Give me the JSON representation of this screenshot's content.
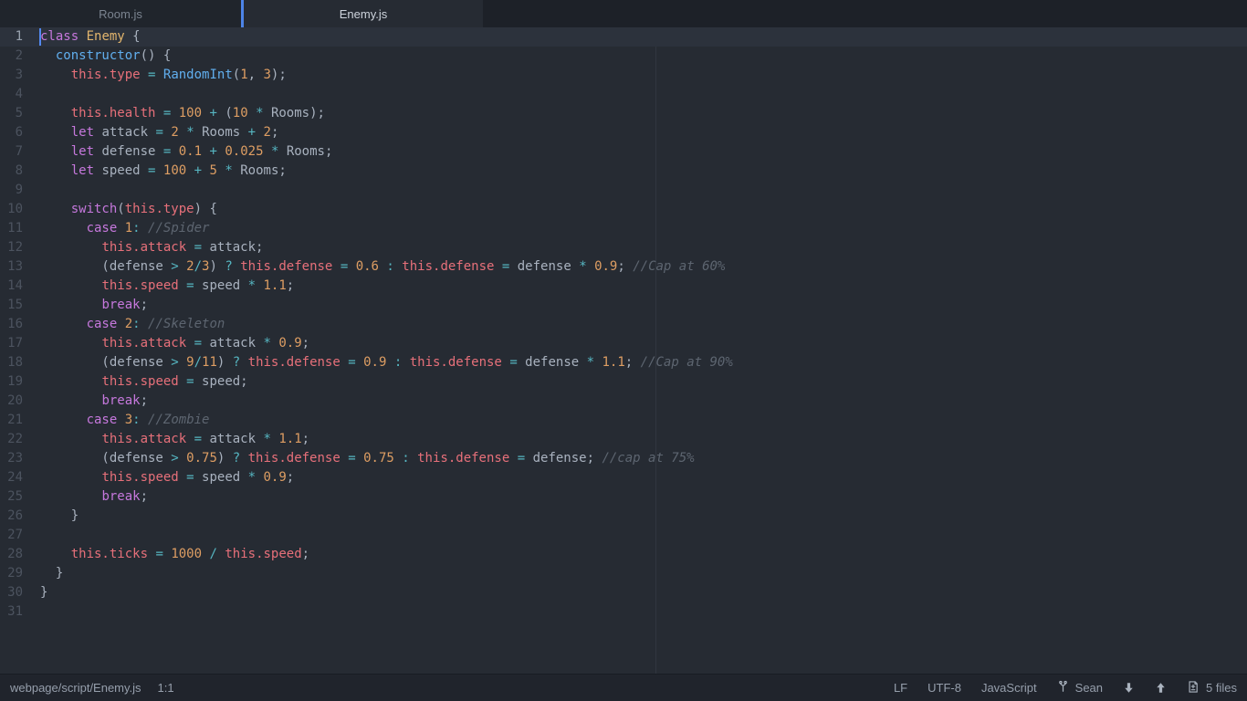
{
  "colors": {
    "bg-editor": "#262b33",
    "bg-tabbar": "#1d2128",
    "bg-tab-inactive": "#20252c",
    "bg-tab-active": "#262b33",
    "bg-statusbar": "#20242c",
    "bg-current-line": "#2c323c",
    "accent": "#4d84e8",
    "caret": "#5389f0",
    "wrap-guide": "#31363f",
    "line-number": "#4c535f",
    "line-number-active": "#98a1ae",
    "tab-text-inactive": "#7b8490",
    "tab-text-active": "#cdd3dc",
    "status-text": "#969fac",
    "status-icon": "#aab3bf",
    "kw": "#c678dd",
    "fn": "#61afef",
    "thiskw": "#e7707a",
    "num": "#de9e63",
    "op": "#56b6c2",
    "pl": "#a9b2bf",
    "cls": "#e2b56d",
    "cm": "#5d6570"
  },
  "tabs": [
    {
      "label": "Room.js",
      "active": false
    },
    {
      "label": "Enemy.js",
      "active": true
    }
  ],
  "editor": {
    "cursor_line": 1,
    "lines": [
      {
        "n": 1,
        "segs": [
          [
            "kw",
            "class"
          ],
          [
            "pl",
            " "
          ],
          [
            "cls",
            "Enemy"
          ],
          [
            "pl",
            " {"
          ]
        ]
      },
      {
        "n": 2,
        "segs": [
          [
            "pl",
            "  "
          ],
          [
            "fn",
            "constructor"
          ],
          [
            "pl",
            "() {"
          ]
        ]
      },
      {
        "n": 3,
        "segs": [
          [
            "pl",
            "    "
          ],
          [
            "this",
            "this.type"
          ],
          [
            "pl",
            " "
          ],
          [
            "op",
            "="
          ],
          [
            "pl",
            " "
          ],
          [
            "fn",
            "RandomInt"
          ],
          [
            "pl",
            "("
          ],
          [
            "num",
            "1"
          ],
          [
            "pl",
            ", "
          ],
          [
            "num",
            "3"
          ],
          [
            "pl",
            ");"
          ]
        ]
      },
      {
        "n": 4,
        "segs": []
      },
      {
        "n": 5,
        "segs": [
          [
            "pl",
            "    "
          ],
          [
            "this",
            "this.health"
          ],
          [
            "pl",
            " "
          ],
          [
            "op",
            "="
          ],
          [
            "pl",
            " "
          ],
          [
            "num",
            "100"
          ],
          [
            "pl",
            " "
          ],
          [
            "op",
            "+"
          ],
          [
            "pl",
            " ("
          ],
          [
            "num",
            "10"
          ],
          [
            "pl",
            " "
          ],
          [
            "op",
            "*"
          ],
          [
            "pl",
            " Rooms);"
          ]
        ]
      },
      {
        "n": 6,
        "segs": [
          [
            "pl",
            "    "
          ],
          [
            "kw",
            "let"
          ],
          [
            "pl",
            " attack "
          ],
          [
            "op",
            "="
          ],
          [
            "pl",
            " "
          ],
          [
            "num",
            "2"
          ],
          [
            "pl",
            " "
          ],
          [
            "op",
            "*"
          ],
          [
            "pl",
            " Rooms "
          ],
          [
            "op",
            "+"
          ],
          [
            "pl",
            " "
          ],
          [
            "num",
            "2"
          ],
          [
            "pl",
            ";"
          ]
        ]
      },
      {
        "n": 7,
        "segs": [
          [
            "pl",
            "    "
          ],
          [
            "kw",
            "let"
          ],
          [
            "pl",
            " defense "
          ],
          [
            "op",
            "="
          ],
          [
            "pl",
            " "
          ],
          [
            "num",
            "0.1"
          ],
          [
            "pl",
            " "
          ],
          [
            "op",
            "+"
          ],
          [
            "pl",
            " "
          ],
          [
            "num",
            "0.025"
          ],
          [
            "pl",
            " "
          ],
          [
            "op",
            "*"
          ],
          [
            "pl",
            " Rooms;"
          ]
        ]
      },
      {
        "n": 8,
        "segs": [
          [
            "pl",
            "    "
          ],
          [
            "kw",
            "let"
          ],
          [
            "pl",
            " speed "
          ],
          [
            "op",
            "="
          ],
          [
            "pl",
            " "
          ],
          [
            "num",
            "100"
          ],
          [
            "pl",
            " "
          ],
          [
            "op",
            "+"
          ],
          [
            "pl",
            " "
          ],
          [
            "num",
            "5"
          ],
          [
            "pl",
            " "
          ],
          [
            "op",
            "*"
          ],
          [
            "pl",
            " Rooms;"
          ]
        ]
      },
      {
        "n": 9,
        "segs": []
      },
      {
        "n": 10,
        "segs": [
          [
            "pl",
            "    "
          ],
          [
            "kw",
            "switch"
          ],
          [
            "pl",
            "("
          ],
          [
            "this",
            "this.type"
          ],
          [
            "pl",
            ") {"
          ]
        ]
      },
      {
        "n": 11,
        "segs": [
          [
            "pl",
            "      "
          ],
          [
            "kw",
            "case"
          ],
          [
            "pl",
            " "
          ],
          [
            "num",
            "1"
          ],
          [
            "op",
            ":"
          ],
          [
            "pl",
            " "
          ],
          [
            "cm",
            "//Spider"
          ]
        ]
      },
      {
        "n": 12,
        "segs": [
          [
            "pl",
            "        "
          ],
          [
            "this",
            "this.attack"
          ],
          [
            "pl",
            " "
          ],
          [
            "op",
            "="
          ],
          [
            "pl",
            " attack;"
          ]
        ]
      },
      {
        "n": 13,
        "segs": [
          [
            "pl",
            "        (defense "
          ],
          [
            "op",
            ">"
          ],
          [
            "pl",
            " "
          ],
          [
            "num",
            "2"
          ],
          [
            "op",
            "/"
          ],
          [
            "num",
            "3"
          ],
          [
            "pl",
            ") "
          ],
          [
            "op",
            "?"
          ],
          [
            "pl",
            " "
          ],
          [
            "this",
            "this.defense"
          ],
          [
            "pl",
            " "
          ],
          [
            "op",
            "="
          ],
          [
            "pl",
            " "
          ],
          [
            "num",
            "0.6"
          ],
          [
            "pl",
            " "
          ],
          [
            "op",
            ":"
          ],
          [
            "pl",
            " "
          ],
          [
            "this",
            "this.defense"
          ],
          [
            "pl",
            " "
          ],
          [
            "op",
            "="
          ],
          [
            "pl",
            " defense "
          ],
          [
            "op",
            "*"
          ],
          [
            "pl",
            " "
          ],
          [
            "num",
            "0.9"
          ],
          [
            "pl",
            "; "
          ],
          [
            "cm",
            "//Cap at 60%"
          ]
        ]
      },
      {
        "n": 14,
        "segs": [
          [
            "pl",
            "        "
          ],
          [
            "this",
            "this.speed"
          ],
          [
            "pl",
            " "
          ],
          [
            "op",
            "="
          ],
          [
            "pl",
            " speed "
          ],
          [
            "op",
            "*"
          ],
          [
            "pl",
            " "
          ],
          [
            "num",
            "1.1"
          ],
          [
            "pl",
            ";"
          ]
        ]
      },
      {
        "n": 15,
        "segs": [
          [
            "pl",
            "        "
          ],
          [
            "kw",
            "break"
          ],
          [
            "pl",
            ";"
          ]
        ]
      },
      {
        "n": 16,
        "segs": [
          [
            "pl",
            "      "
          ],
          [
            "kw",
            "case"
          ],
          [
            "pl",
            " "
          ],
          [
            "num",
            "2"
          ],
          [
            "op",
            ":"
          ],
          [
            "pl",
            " "
          ],
          [
            "cm",
            "//Skeleton"
          ]
        ]
      },
      {
        "n": 17,
        "segs": [
          [
            "pl",
            "        "
          ],
          [
            "this",
            "this.attack"
          ],
          [
            "pl",
            " "
          ],
          [
            "op",
            "="
          ],
          [
            "pl",
            " attack "
          ],
          [
            "op",
            "*"
          ],
          [
            "pl",
            " "
          ],
          [
            "num",
            "0.9"
          ],
          [
            "pl",
            ";"
          ]
        ]
      },
      {
        "n": 18,
        "segs": [
          [
            "pl",
            "        (defense "
          ],
          [
            "op",
            ">"
          ],
          [
            "pl",
            " "
          ],
          [
            "num",
            "9"
          ],
          [
            "op",
            "/"
          ],
          [
            "num",
            "11"
          ],
          [
            "pl",
            ") "
          ],
          [
            "op",
            "?"
          ],
          [
            "pl",
            " "
          ],
          [
            "this",
            "this.defense"
          ],
          [
            "pl",
            " "
          ],
          [
            "op",
            "="
          ],
          [
            "pl",
            " "
          ],
          [
            "num",
            "0.9"
          ],
          [
            "pl",
            " "
          ],
          [
            "op",
            ":"
          ],
          [
            "pl",
            " "
          ],
          [
            "this",
            "this.defense"
          ],
          [
            "pl",
            " "
          ],
          [
            "op",
            "="
          ],
          [
            "pl",
            " defense "
          ],
          [
            "op",
            "*"
          ],
          [
            "pl",
            " "
          ],
          [
            "num",
            "1.1"
          ],
          [
            "pl",
            "; "
          ],
          [
            "cm",
            "//Cap at 90%"
          ]
        ]
      },
      {
        "n": 19,
        "segs": [
          [
            "pl",
            "        "
          ],
          [
            "this",
            "this.speed"
          ],
          [
            "pl",
            " "
          ],
          [
            "op",
            "="
          ],
          [
            "pl",
            " speed;"
          ]
        ]
      },
      {
        "n": 20,
        "segs": [
          [
            "pl",
            "        "
          ],
          [
            "kw",
            "break"
          ],
          [
            "pl",
            ";"
          ]
        ]
      },
      {
        "n": 21,
        "segs": [
          [
            "pl",
            "      "
          ],
          [
            "kw",
            "case"
          ],
          [
            "pl",
            " "
          ],
          [
            "num",
            "3"
          ],
          [
            "op",
            ":"
          ],
          [
            "pl",
            " "
          ],
          [
            "cm",
            "//Zombie"
          ]
        ]
      },
      {
        "n": 22,
        "segs": [
          [
            "pl",
            "        "
          ],
          [
            "this",
            "this.attack"
          ],
          [
            "pl",
            " "
          ],
          [
            "op",
            "="
          ],
          [
            "pl",
            " attack "
          ],
          [
            "op",
            "*"
          ],
          [
            "pl",
            " "
          ],
          [
            "num",
            "1.1"
          ],
          [
            "pl",
            ";"
          ]
        ]
      },
      {
        "n": 23,
        "segs": [
          [
            "pl",
            "        (defense "
          ],
          [
            "op",
            ">"
          ],
          [
            "pl",
            " "
          ],
          [
            "num",
            "0.75"
          ],
          [
            "pl",
            ") "
          ],
          [
            "op",
            "?"
          ],
          [
            "pl",
            " "
          ],
          [
            "this",
            "this.defense"
          ],
          [
            "pl",
            " "
          ],
          [
            "op",
            "="
          ],
          [
            "pl",
            " "
          ],
          [
            "num",
            "0.75"
          ],
          [
            "pl",
            " "
          ],
          [
            "op",
            ":"
          ],
          [
            "pl",
            " "
          ],
          [
            "this",
            "this.defense"
          ],
          [
            "pl",
            " "
          ],
          [
            "op",
            "="
          ],
          [
            "pl",
            " defense; "
          ],
          [
            "cm",
            "//cap at 75%"
          ]
        ]
      },
      {
        "n": 24,
        "segs": [
          [
            "pl",
            "        "
          ],
          [
            "this",
            "this.speed"
          ],
          [
            "pl",
            " "
          ],
          [
            "op",
            "="
          ],
          [
            "pl",
            " speed "
          ],
          [
            "op",
            "*"
          ],
          [
            "pl",
            " "
          ],
          [
            "num",
            "0.9"
          ],
          [
            "pl",
            ";"
          ]
        ]
      },
      {
        "n": 25,
        "segs": [
          [
            "pl",
            "        "
          ],
          [
            "kw",
            "break"
          ],
          [
            "pl",
            ";"
          ]
        ]
      },
      {
        "n": 26,
        "segs": [
          [
            "pl",
            "    }"
          ]
        ]
      },
      {
        "n": 27,
        "segs": []
      },
      {
        "n": 28,
        "segs": [
          [
            "pl",
            "    "
          ],
          [
            "this",
            "this.ticks"
          ],
          [
            "pl",
            " "
          ],
          [
            "op",
            "="
          ],
          [
            "pl",
            " "
          ],
          [
            "num",
            "1000"
          ],
          [
            "pl",
            " "
          ],
          [
            "op",
            "/"
          ],
          [
            "pl",
            " "
          ],
          [
            "this",
            "this.speed"
          ],
          [
            "pl",
            ";"
          ]
        ]
      },
      {
        "n": 29,
        "segs": [
          [
            "pl",
            "  }"
          ]
        ]
      },
      {
        "n": 30,
        "segs": [
          [
            "pl",
            "}"
          ]
        ]
      },
      {
        "n": 31,
        "segs": []
      }
    ]
  },
  "status_bar": {
    "file_path": "webpage/script/Enemy.js",
    "cursor_position": "1:1",
    "eol": "LF",
    "encoding": "UTF-8",
    "language": "JavaScript",
    "git_branch": "Sean",
    "files_count": "5 files"
  }
}
